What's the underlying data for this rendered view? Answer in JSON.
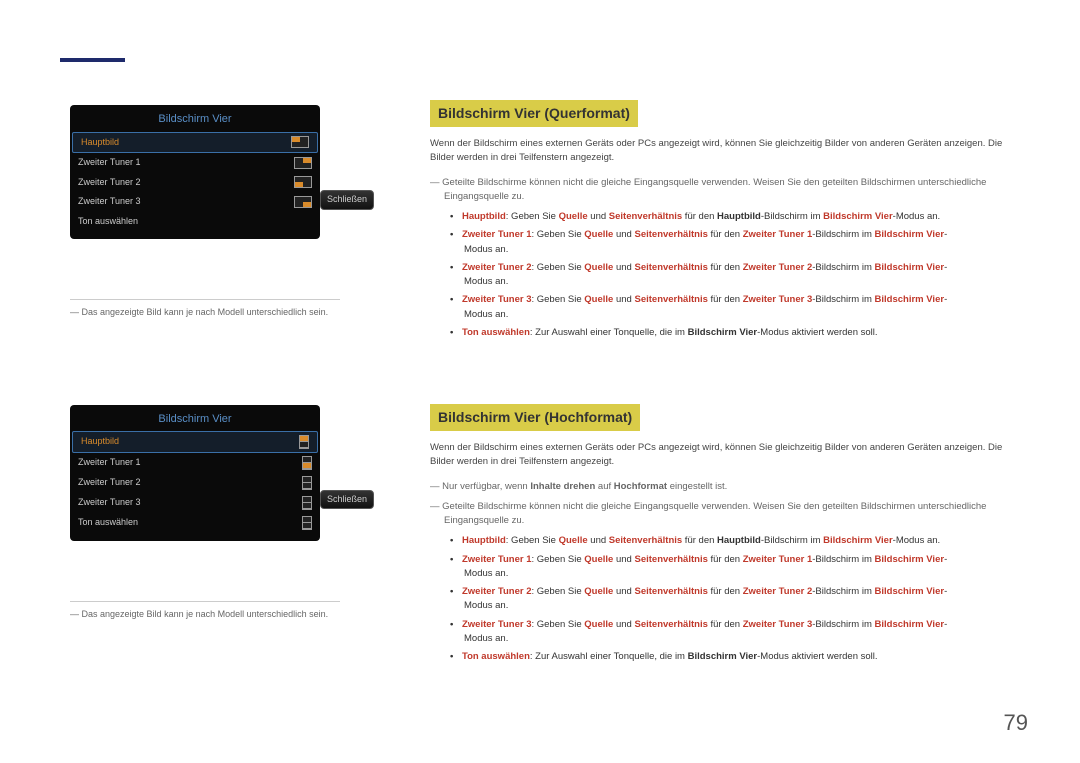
{
  "page_number": "79",
  "left": {
    "screen_title": "Bildschirm Vier",
    "hauptbild": "Hauptbild",
    "rows": [
      "Zweiter Tuner 1",
      "Zweiter Tuner 2",
      "Zweiter Tuner 3",
      "Ton auswählen"
    ],
    "close": "Schließen",
    "footnote": "Das angezeigte Bild kann je nach Modell unterschiedlich sein."
  },
  "section1": {
    "title": "Bildschirm Vier (Querformat)",
    "intro": "Wenn der Bildschirm eines externen Geräts oder PCs angezeigt wird, können Sie gleichzeitig Bilder von anderen Geräten anzeigen. Die Bilder werden in drei Teilfenstern angezeigt.",
    "note1": "Geteilte Bildschirme können nicht die gleiche Eingangsquelle verwenden. Weisen Sie den geteilten Bildschirmen unterschiedliche Eingangsquelle zu.",
    "bullets": {
      "hauptbild_pre": "Hauptbild",
      "hauptbild_mid1": ": Geben Sie ",
      "quelle": "Quelle",
      "und": " und ",
      "sv": "Seitenverhältnis",
      "fur": " für den ",
      "hauptbild_b": "Hauptbild",
      "bs_in": "-Bildschirm im ",
      "bv": "Bildschirm Vier",
      "modus": "-Modus an.",
      "zt1": "Zweiter Tuner 1",
      "zt2": "Zweiter Tuner 2",
      "zt3": "Zweiter Tuner 3",
      "ton_pre": "Ton auswählen",
      "ton_text": ": Zur Auswahl einer Tonquelle, die im ",
      "ton_end": "-Modus aktiviert werden soll."
    }
  },
  "section2": {
    "title": "Bildschirm Vier (Hochformat)",
    "intro": "Wenn der Bildschirm eines externen Geräts oder PCs angezeigt wird, können Sie gleichzeitig Bilder von anderen Geräten anzeigen. Die Bilder werden in drei Teilfenstern angezeigt.",
    "note0_pre": "Nur verfügbar, wenn ",
    "note0_b1": "Inhalte drehen",
    "note0_mid": " auf ",
    "note0_b2": "Hochformat",
    "note0_end": " eingestellt ist.",
    "note1": "Geteilte Bildschirme können nicht die gleiche Eingangsquelle verwenden. Weisen Sie den geteilten Bildschirmen unterschiedliche Eingangsquelle zu."
  }
}
